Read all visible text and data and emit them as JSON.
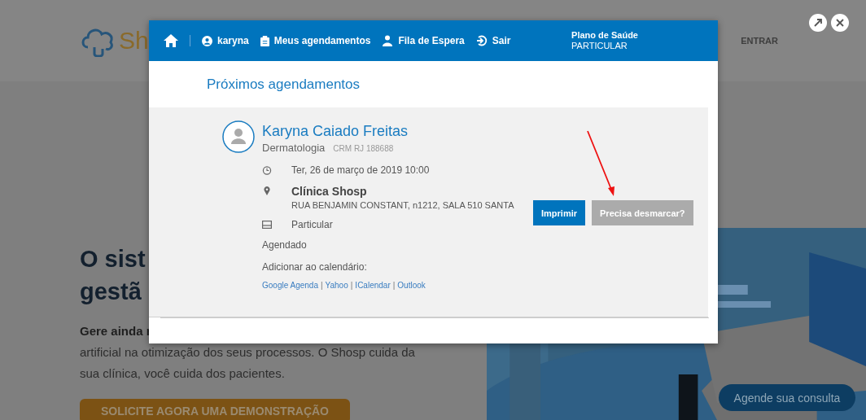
{
  "background_page": {
    "logo_text": "Sh",
    "nav_link": "ENTRAR",
    "hero_title_lines": [
      "O sist",
      "gestã"
    ],
    "hero_text_lines": [
      {
        "text": "Gere ainda r",
        "bold": true
      },
      {
        "text": "artificial na otimização dos seus processos. O Shosp cuida da",
        "bold": false
      },
      {
        "text": "sua clínica, você cuida dos pacientes.",
        "bold": false
      }
    ],
    "cta_button": "SOLICITE AGORA UMA DEMONSTRAÇÃO",
    "chat_button": "Agende sua consulta"
  },
  "modal": {
    "nav": [
      {
        "kind": "home"
      },
      {
        "kind": "user",
        "label": "karyna"
      },
      {
        "kind": "clipboard",
        "label": "Meus agendamentos"
      },
      {
        "kind": "queue",
        "label": "Fila de Espera"
      },
      {
        "kind": "logout",
        "label": "Sair"
      }
    ],
    "plan_label": "Plano de Saúde",
    "plan_value": "PARTICULAR",
    "title": "Próximos agendamentos",
    "appointment": {
      "doctor": "Karyna Caiado Freitas",
      "specialty": "Dermatologia",
      "crm": "CRM RJ 188688",
      "details": [
        {
          "kind": "time",
          "text": "Ter, 26 de março de 2019 10:00"
        },
        {
          "kind": "place",
          "title": "Clínica Shosp",
          "text": "RUA BENJAMIN CONSTANT, n1212, SALA 510 SANTA"
        },
        {
          "kind": "payment",
          "text": "Particular"
        }
      ],
      "status": "Agendado",
      "calendar_label": "Adicionar ao calendário:",
      "calendar_links": [
        {
          "label": "Google Agenda"
        },
        {
          "separator": "|",
          "label": "Yahoo"
        },
        {
          "separator": "|",
          "label": "ICalendar"
        },
        {
          "separator": "|",
          "label": "Outlook"
        }
      ],
      "buttons": [
        {
          "kind": "primary",
          "label": "Imprimir"
        },
        {
          "kind": "secondary",
          "label": "Precisa desmarcar?"
        }
      ]
    }
  }
}
